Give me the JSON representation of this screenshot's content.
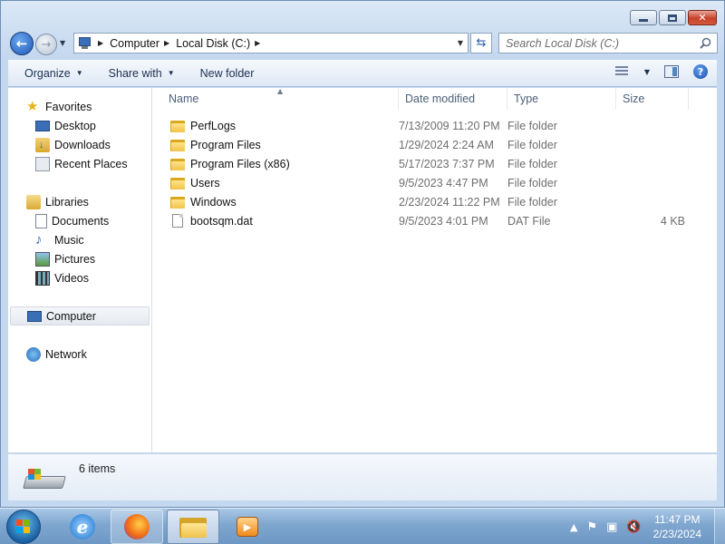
{
  "window": {
    "caption_buttons": {
      "minimize": "minimize",
      "maximize": "maximize",
      "close": "close"
    }
  },
  "address": {
    "crumbs": [
      "Computer",
      "Local Disk (C:)"
    ]
  },
  "search": {
    "placeholder": "Search Local Disk (C:)"
  },
  "toolbar": {
    "organize": "Organize",
    "share_with": "Share with",
    "new_folder": "New folder"
  },
  "nav": {
    "favorites": "Favorites",
    "desktop": "Desktop",
    "downloads": "Downloads",
    "recent_places": "Recent Places",
    "libraries": "Libraries",
    "documents": "Documents",
    "music": "Music",
    "pictures": "Pictures",
    "videos": "Videos",
    "computer": "Computer",
    "network": "Network"
  },
  "columns": {
    "name": "Name",
    "date": "Date modified",
    "type": "Type",
    "size": "Size"
  },
  "files": [
    {
      "name": "PerfLogs",
      "date": "7/13/2009 11:20 PM",
      "type": "File folder",
      "size": "",
      "icon": "folder-icon"
    },
    {
      "name": "Program Files",
      "date": "1/29/2024 2:24 AM",
      "type": "File folder",
      "size": "",
      "icon": "folder-icon"
    },
    {
      "name": "Program Files (x86)",
      "date": "5/17/2023 7:37 PM",
      "type": "File folder",
      "size": "",
      "icon": "folder-icon"
    },
    {
      "name": "Users",
      "date": "9/5/2023 4:47 PM",
      "type": "File folder",
      "size": "",
      "icon": "folder-icon"
    },
    {
      "name": "Windows",
      "date": "2/23/2024 11:22 PM",
      "type": "File folder",
      "size": "",
      "icon": "folder-icon"
    },
    {
      "name": "bootsqm.dat",
      "date": "9/5/2023 4:01 PM",
      "type": "DAT File",
      "size": "4 KB",
      "icon": "file-icon"
    }
  ],
  "details": {
    "count": "6 items"
  },
  "taskbar": {
    "time": "11:47 PM",
    "date": "2/23/2024"
  },
  "colors": {
    "accent": "#1f59b8",
    "folder": "#f1c34a",
    "taskbar": "#7fa6cf"
  }
}
